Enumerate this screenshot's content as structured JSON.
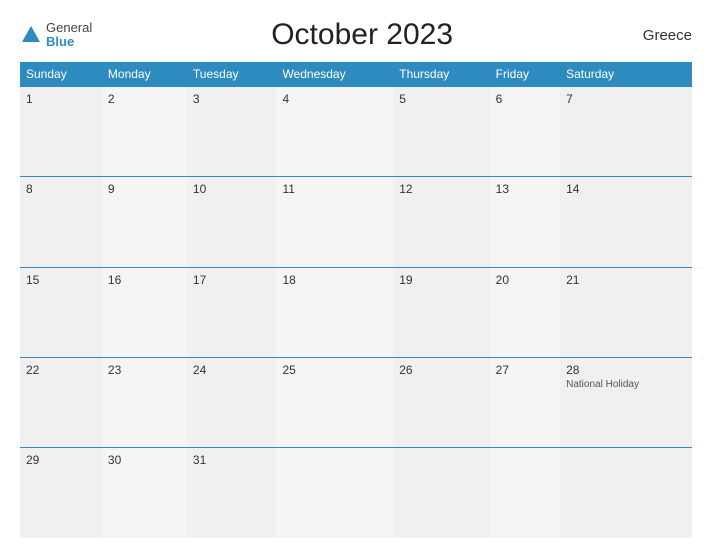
{
  "logo": {
    "general": "General",
    "blue": "Blue"
  },
  "title": "October 2023",
  "country": "Greece",
  "weekdays": [
    "Sunday",
    "Monday",
    "Tuesday",
    "Wednesday",
    "Thursday",
    "Friday",
    "Saturday"
  ],
  "weeks": [
    [
      {
        "num": "1",
        "event": ""
      },
      {
        "num": "2",
        "event": ""
      },
      {
        "num": "3",
        "event": ""
      },
      {
        "num": "4",
        "event": ""
      },
      {
        "num": "5",
        "event": ""
      },
      {
        "num": "6",
        "event": ""
      },
      {
        "num": "7",
        "event": ""
      }
    ],
    [
      {
        "num": "8",
        "event": ""
      },
      {
        "num": "9",
        "event": ""
      },
      {
        "num": "10",
        "event": ""
      },
      {
        "num": "11",
        "event": ""
      },
      {
        "num": "12",
        "event": ""
      },
      {
        "num": "13",
        "event": ""
      },
      {
        "num": "14",
        "event": ""
      }
    ],
    [
      {
        "num": "15",
        "event": ""
      },
      {
        "num": "16",
        "event": ""
      },
      {
        "num": "17",
        "event": ""
      },
      {
        "num": "18",
        "event": ""
      },
      {
        "num": "19",
        "event": ""
      },
      {
        "num": "20",
        "event": ""
      },
      {
        "num": "21",
        "event": ""
      }
    ],
    [
      {
        "num": "22",
        "event": ""
      },
      {
        "num": "23",
        "event": ""
      },
      {
        "num": "24",
        "event": ""
      },
      {
        "num": "25",
        "event": ""
      },
      {
        "num": "26",
        "event": ""
      },
      {
        "num": "27",
        "event": ""
      },
      {
        "num": "28",
        "event": "National Holiday"
      }
    ],
    [
      {
        "num": "29",
        "event": ""
      },
      {
        "num": "30",
        "event": ""
      },
      {
        "num": "31",
        "event": ""
      },
      {
        "num": "",
        "event": ""
      },
      {
        "num": "",
        "event": ""
      },
      {
        "num": "",
        "event": ""
      },
      {
        "num": "",
        "event": ""
      }
    ]
  ]
}
